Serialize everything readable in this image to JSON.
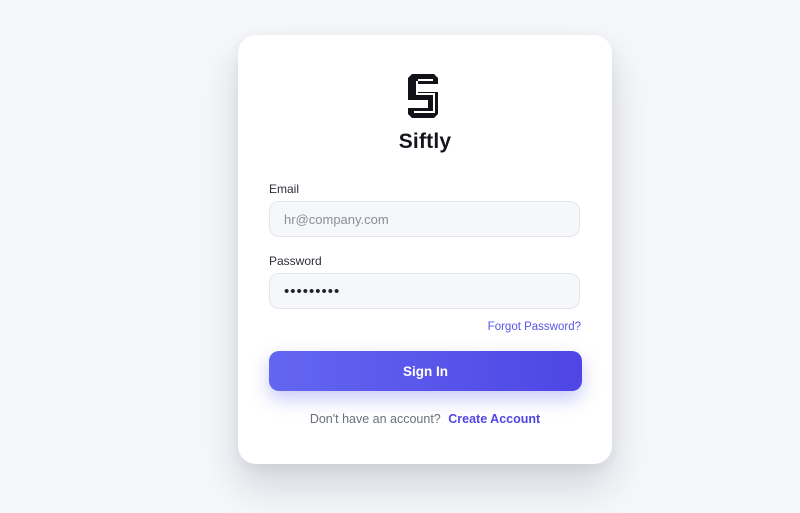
{
  "brand": {
    "name": "Siftly",
    "logo_icon": "siftly-s-logo-icon"
  },
  "form": {
    "email": {
      "label": "Email",
      "placeholder": "hr@company.com",
      "value": ""
    },
    "password": {
      "label": "Password",
      "placeholder": "",
      "value": "•••••••••"
    },
    "forgot_password_label": "Forgot Password?",
    "submit_label": "Sign In"
  },
  "footer": {
    "prompt": "Don't have an account?",
    "create_account_label": "Create Account"
  },
  "colors": {
    "accent": "#4f46e5",
    "accent_light": "#6366f1",
    "background": "#f5f7fa",
    "card": "#ffffff"
  }
}
